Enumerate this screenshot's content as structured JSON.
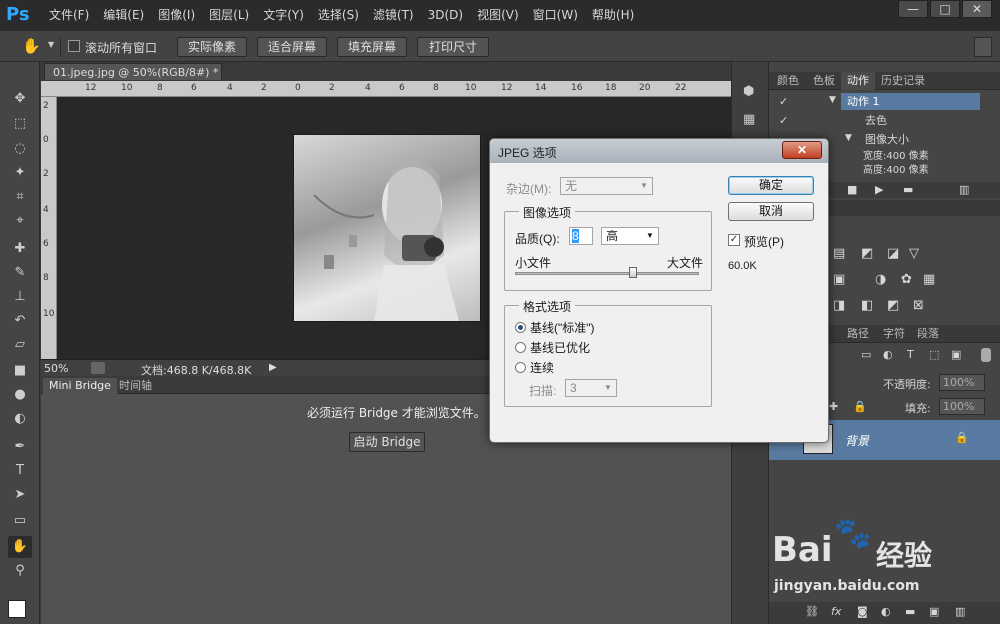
{
  "app": {
    "logo": "Ps"
  },
  "menubar": {
    "items": [
      "文件(F)",
      "编辑(E)",
      "图像(I)",
      "图层(L)",
      "文字(Y)",
      "选择(S)",
      "滤镜(T)",
      "3D(D)",
      "视图(V)",
      "窗口(W)",
      "帮助(H)"
    ]
  },
  "window_controls": {
    "minimize": "—",
    "maximize": "□",
    "close": "✕"
  },
  "options_bar": {
    "scroll_all_label": "滚动所有窗口",
    "btn_actual": "实际像素",
    "btn_fit": "适合屏幕",
    "btn_fill": "填充屏幕",
    "btn_print": "打印尺寸"
  },
  "document": {
    "tab_title": "01.jpeg.jpg @ 50%(RGB/8#) *",
    "tab_close": "×",
    "ruler_h": [
      "12",
      "10",
      "8",
      "6",
      "4",
      "2",
      "0",
      "2",
      "4",
      "6",
      "8",
      "10",
      "12",
      "14",
      "16",
      "18",
      "20",
      "22"
    ],
    "ruler_v": [
      "2",
      "0",
      "2",
      "4",
      "6",
      "8",
      "10"
    ],
    "zoom": "50%",
    "doc_info": "文档:468.8 K/468.8K"
  },
  "mini_bridge": {
    "tabs": [
      "Mini Bridge",
      "时间轴"
    ],
    "message": "必须运行 Bridge 才能浏览文件。",
    "launch_button": "启动 Bridge"
  },
  "actions_panel": {
    "tabs": [
      "颜色",
      "色板",
      "动作",
      "历史记录"
    ],
    "active_tab": "动作",
    "rows": [
      {
        "label": "动作 1",
        "selected": true
      },
      {
        "label": "去色",
        "selected": false
      },
      {
        "label": "图像大小",
        "selected": false
      },
      {
        "label": "宽度:400 像素",
        "selected": false
      },
      {
        "label": "高度:400 像素",
        "selected": false
      }
    ]
  },
  "layers_panel": {
    "tabs": [
      "路径",
      "字符",
      "段落"
    ],
    "opacity_label": "不透明度:",
    "opacity_value": "100%",
    "fill_label": "填充:",
    "fill_value": "100%",
    "layer_name": "背景"
  },
  "dialog": {
    "title": "JPEG 选项",
    "close": "✕",
    "matte_label": "杂边(M):",
    "matte_value": "无",
    "image_options_legend": "图像选项",
    "quality_label": "品质(Q):",
    "quality_value": "8",
    "quality_preset": "高",
    "small_file": "小文件",
    "large_file": "大文件",
    "slider_fraction": 0.64,
    "format_options_legend": "格式选项",
    "radio_baseline": "基线(\"标准\")",
    "radio_optimized": "基线已优化",
    "radio_progressive": "连续",
    "scans_label": "扫描:",
    "scans_value": "3",
    "ok": "确定",
    "cancel": "取消",
    "preview_label": "预览(P)",
    "file_size": "60.0K"
  },
  "watermark": {
    "brand": "Bai",
    "brand2": "经验",
    "url": "jingyan.baidu.com"
  }
}
